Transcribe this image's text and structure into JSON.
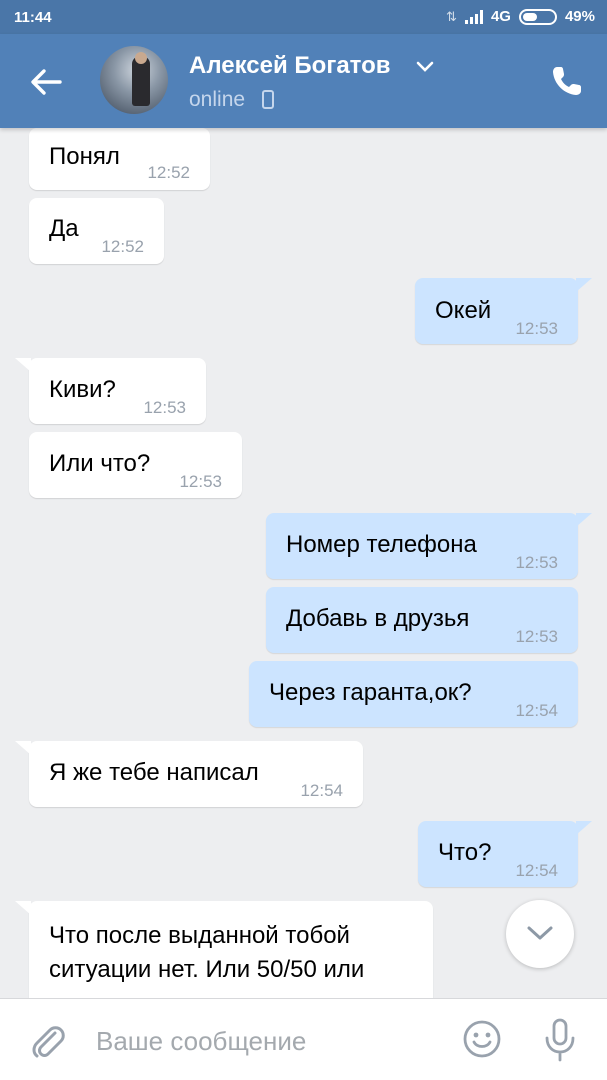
{
  "status_bar": {
    "time": "11:44",
    "network": "4G",
    "battery": "49%"
  },
  "header": {
    "name": "Алексей Богатов",
    "status": "online"
  },
  "messages": [
    {
      "dir": "in",
      "text": "Понял",
      "time": "12:52"
    },
    {
      "dir": "in",
      "text": "Да",
      "time": "12:52"
    },
    {
      "dir": "out",
      "text": "Окей",
      "time": "12:53"
    },
    {
      "dir": "in",
      "text": "Киви?",
      "time": "12:53"
    },
    {
      "dir": "in",
      "text": "Или что?",
      "time": "12:53"
    },
    {
      "dir": "out",
      "text": "Номер телефона",
      "time": "12:53"
    },
    {
      "dir": "out",
      "text": "Добавь в друзья",
      "time": "12:53"
    },
    {
      "dir": "out",
      "text": "Через гаранта,ок?",
      "time": "12:54"
    },
    {
      "dir": "in",
      "text": "Я же тебе написал",
      "time": "12:54"
    },
    {
      "dir": "out",
      "text": "Что?",
      "time": "12:54"
    }
  ],
  "partial_message": {
    "line1": "Что после выданной тобой",
    "line2": "ситуации нет. Или 50/50 или"
  },
  "composer": {
    "placeholder": "Ваше сообщение"
  }
}
